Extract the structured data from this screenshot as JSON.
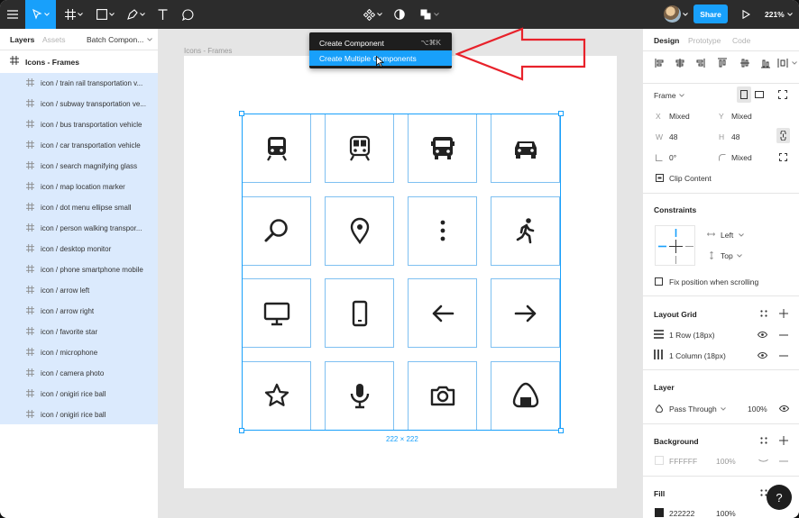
{
  "toolbar": {
    "share_label": "Share",
    "zoom": "221%"
  },
  "menu": {
    "items": [
      {
        "label": "Create Component",
        "shortcut": "⌥⌘K"
      },
      {
        "label": "Create Multiple Components",
        "shortcut": ""
      }
    ]
  },
  "left_panel": {
    "tabs": [
      "Layers",
      "Assets"
    ],
    "page": "Batch Compon...",
    "frame": "Icons - Frames",
    "layers": [
      "icon / train rail transportation v...",
      "icon / subway transportation ve...",
      "icon / bus transportation vehicle",
      "icon / car transportation vehicle",
      "icon / search magnifying glass",
      "icon / map location marker",
      "icon / dot menu ellipse small",
      "icon / person walking transpor...",
      "icon / desktop monitor",
      "icon / phone smartphone mobile",
      "icon / arrow left",
      "icon / arrow right",
      "icon / favorite star",
      "icon / microphone",
      "icon / camera photo",
      "icon / onigiri rice ball",
      "icon / onigiri rice ball"
    ]
  },
  "canvas": {
    "frame_title": "Icons - Frames",
    "size_label": "222 × 222",
    "icons": [
      "train-icon",
      "subway-icon",
      "bus-icon",
      "car-icon",
      "search-icon",
      "location-marker-icon",
      "dot-menu-icon",
      "person-walking-icon",
      "desktop-monitor-icon",
      "smartphone-icon",
      "arrow-left-icon",
      "arrow-right-icon",
      "star-icon",
      "microphone-icon",
      "camera-icon",
      "onigiri-icon"
    ]
  },
  "right_panel": {
    "tabs": [
      "Design",
      "Prototype",
      "Code"
    ],
    "frame_label": "Frame",
    "x_label": "X",
    "x_value": "Mixed",
    "y_label": "Y",
    "y_value": "Mixed",
    "w_label": "W",
    "w_value": "48",
    "h_label": "H",
    "h_value": "48",
    "rotation": "0°",
    "radius": "Mixed",
    "clip_content": "Clip Content",
    "constraints_title": "Constraints",
    "constraint_h": "Left",
    "constraint_v": "Top",
    "fix_position": "Fix position when scrolling",
    "layout_grid_title": "Layout Grid",
    "grid_row": "1 Row (18px)",
    "grid_col": "1 Column (18px)",
    "layer_title": "Layer",
    "blend": "Pass Through",
    "layer_opacity": "100%",
    "background_title": "Background",
    "bg_hex": "FFFFFF",
    "bg_opacity": "100%",
    "fill_title": "Fill",
    "fill_hex": "222222",
    "fill_opacity": "100%"
  },
  "colors": {
    "accent": "#18a0fb",
    "toolbar": "#2c2c2c",
    "selection": "#dbeafd",
    "annotation": "#e8222b"
  }
}
